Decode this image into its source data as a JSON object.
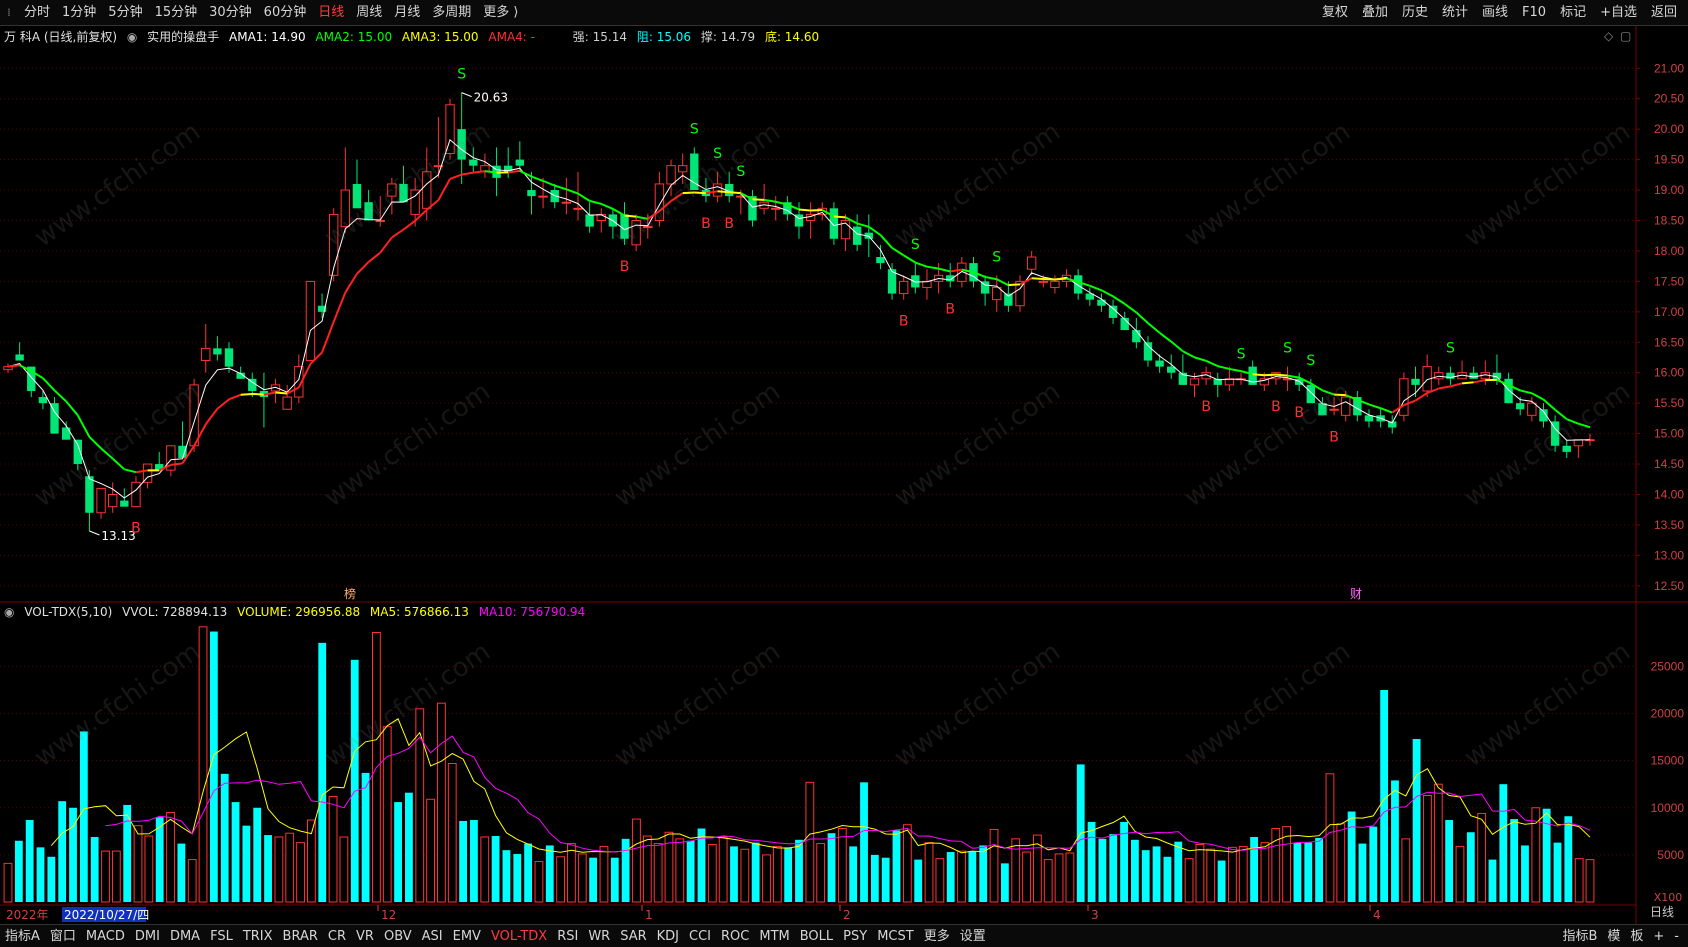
{
  "toolbar": {
    "tabs": [
      "分时",
      "1分钟",
      "5分钟",
      "15分钟",
      "30分钟",
      "60分钟",
      "日线",
      "周线",
      "月线",
      "多周期",
      "更多 ⟩"
    ],
    "active_tab": "日线",
    "right_buttons": [
      "复权",
      "叠加",
      "历史",
      "统计",
      "画线",
      "F10",
      "标记",
      "+自选",
      "返回"
    ]
  },
  "info": {
    "stock": "万 科A (日线,前复权)",
    "indicator": "实用的操盘手",
    "ama1": "AMA1: 14.90",
    "ama2": "AMA2: 15.00",
    "ama3": "AMA3: 15.00",
    "ama4": "AMA4: -",
    "qiang": "强: 15.14",
    "zu": "阻: 15.06",
    "cheng": "撑: 14.79",
    "di": "底: 14.60"
  },
  "vol_info": {
    "name": "VOL-TDX(5,10)",
    "vvol": "VVOL: 728894.13",
    "volume": "VOLUME: 296956.88",
    "ma5": "MA5: 576866.13",
    "ma10": "MA10: 756790.94"
  },
  "colors": {
    "up": "#ff3232",
    "down": "#00e676",
    "vol_down": "#00ffff",
    "ama_white": "#ffffff",
    "ama_red": "#ff2020",
    "ama_yellow": "#ffff00",
    "ama_green": "#00ff00",
    "ma5": "#ffff00",
    "ma10": "#ff00ff",
    "grid": "#5a0000"
  },
  "price_labels": {
    "high": "20.63",
    "low": "13.13"
  },
  "markers": {
    "zhe": "榜",
    "cai": "财"
  },
  "date_labels": {
    "year": "2022年",
    "cursor_date": "2022/10/27/四",
    "months": [
      "12",
      "1",
      "2",
      "3",
      "4"
    ]
  },
  "vol_unit": "X100",
  "bottom": {
    "tabs": [
      "指标A",
      "窗口",
      "MACD",
      "DMI",
      "DMA",
      "FSL",
      "TRIX",
      "BRAR",
      "CR",
      "VR",
      "OBV",
      "ASI",
      "EMV",
      "VOL-TDX",
      "RSI",
      "WR",
      "SAR",
      "KDJ",
      "CCI",
      "ROC",
      "MTM",
      "BOLL",
      "PSY",
      "MCST",
      "更多",
      "设置"
    ],
    "active": "VOL-TDX",
    "right": [
      "指标B",
      "模",
      "板",
      "+",
      "-"
    ],
    "period": "日线"
  },
  "watermark": "www.cfchi.com",
  "chart_data": {
    "type": "candlestick",
    "price_axis": {
      "ticks": [
        21.0,
        20.5,
        20.0,
        19.5,
        19.0,
        18.5,
        18.0,
        17.5,
        17.0,
        16.5,
        16.0,
        15.5,
        15.0,
        14.5,
        14.0,
        13.5,
        13.0,
        12.5
      ],
      "range": [
        12.3,
        21.3
      ]
    },
    "volume_axis": {
      "ticks": [
        25000,
        20000,
        15000,
        10000,
        5000
      ],
      "range": [
        0,
        29500
      ]
    },
    "candles": [
      [
        16.05,
        16.15,
        16.0,
        16.1
      ],
      [
        16.3,
        16.5,
        16.2,
        16.2
      ],
      [
        16.1,
        16.1,
        15.6,
        15.7
      ],
      [
        15.6,
        15.7,
        15.4,
        15.5
      ],
      [
        15.5,
        15.6,
        15.0,
        15.0
      ],
      [
        15.1,
        15.2,
        14.9,
        14.9
      ],
      [
        14.9,
        14.9,
        14.4,
        14.5
      ],
      [
        14.3,
        14.4,
        13.4,
        13.7
      ],
      [
        13.7,
        14.1,
        13.6,
        14.1
      ],
      [
        13.8,
        14.2,
        13.7,
        14.0
      ],
      [
        13.9,
        14.1,
        13.8,
        13.8
      ],
      [
        13.8,
        14.3,
        13.8,
        14.2
      ],
      [
        14.2,
        14.5,
        14.1,
        14.5
      ],
      [
        14.5,
        14.7,
        14.4,
        14.4
      ],
      [
        14.4,
        14.8,
        14.3,
        14.8
      ],
      [
        14.8,
        15.2,
        14.7,
        14.6
      ],
      [
        14.8,
        15.9,
        14.7,
        15.8
      ],
      [
        16.2,
        16.8,
        16.0,
        16.4
      ],
      [
        16.4,
        16.6,
        16.2,
        16.3
      ],
      [
        16.4,
        16.5,
        16.0,
        16.1
      ],
      [
        16.0,
        16.1,
        15.9,
        15.9
      ],
      [
        15.9,
        16.0,
        15.6,
        15.7
      ],
      [
        15.7,
        16.0,
        15.1,
        15.6
      ],
      [
        15.7,
        15.9,
        15.5,
        15.8
      ],
      [
        15.4,
        15.8,
        15.4,
        15.6
      ],
      [
        15.6,
        16.3,
        15.5,
        16.1
      ],
      [
        16.2,
        17.5,
        16.2,
        17.5
      ],
      [
        17.1,
        17.3,
        16.9,
        17.0
      ],
      [
        17.6,
        18.7,
        17.5,
        18.6
      ],
      [
        18.4,
        19.7,
        18.3,
        19.0
      ],
      [
        19.1,
        19.5,
        18.8,
        18.7
      ],
      [
        18.8,
        19.0,
        18.5,
        18.5
      ],
      [
        18.5,
        18.9,
        18.4,
        18.5
      ],
      [
        18.9,
        19.2,
        18.6,
        19.1
      ],
      [
        19.1,
        19.4,
        18.8,
        18.8
      ],
      [
        18.6,
        19.2,
        18.4,
        19.0
      ],
      [
        18.7,
        19.7,
        18.5,
        19.3
      ],
      [
        19.4,
        20.2,
        19.2,
        19.4
      ],
      [
        19.6,
        20.5,
        19.5,
        20.4
      ],
      [
        20.0,
        20.6,
        19.1,
        19.5
      ],
      [
        19.5,
        19.7,
        19.3,
        19.4
      ],
      [
        19.3,
        19.6,
        19.2,
        19.4
      ],
      [
        19.4,
        19.7,
        18.9,
        19.2
      ],
      [
        19.4,
        19.7,
        19.2,
        19.3
      ],
      [
        19.5,
        19.8,
        19.3,
        19.4
      ],
      [
        19.0,
        19.3,
        18.6,
        18.9
      ],
      [
        18.9,
        19.2,
        18.7,
        18.9
      ],
      [
        19.0,
        19.1,
        18.7,
        18.8
      ],
      [
        18.8,
        19.2,
        18.6,
        18.8
      ],
      [
        18.7,
        19.3,
        18.5,
        18.7
      ],
      [
        18.6,
        18.8,
        18.3,
        18.4
      ],
      [
        18.5,
        18.7,
        18.3,
        18.6
      ],
      [
        18.6,
        18.7,
        18.2,
        18.4
      ],
      [
        18.6,
        18.8,
        18.1,
        18.2
      ],
      [
        18.1,
        18.6,
        18.0,
        18.5
      ],
      [
        18.4,
        18.6,
        18.2,
        18.4
      ],
      [
        18.5,
        19.3,
        18.4,
        19.1
      ],
      [
        19.1,
        19.5,
        18.9,
        19.4
      ],
      [
        19.3,
        19.6,
        19.1,
        19.4
      ],
      [
        19.6,
        19.7,
        19.0,
        19.0
      ],
      [
        19.0,
        19.2,
        18.8,
        18.9
      ],
      [
        18.9,
        19.3,
        18.8,
        19.1
      ],
      [
        19.1,
        19.3,
        18.8,
        18.9
      ],
      [
        18.9,
        19.0,
        18.6,
        18.9
      ],
      [
        18.9,
        19.0,
        18.4,
        18.5
      ],
      [
        18.7,
        19.1,
        18.6,
        18.8
      ],
      [
        18.7,
        18.9,
        18.5,
        18.7
      ],
      [
        18.8,
        18.9,
        18.5,
        18.6
      ],
      [
        18.6,
        18.8,
        18.2,
        18.4
      ],
      [
        18.5,
        18.8,
        18.2,
        18.6
      ],
      [
        18.6,
        18.8,
        18.5,
        18.7
      ],
      [
        18.7,
        18.8,
        18.1,
        18.2
      ],
      [
        18.2,
        18.6,
        18.0,
        18.5
      ],
      [
        18.4,
        18.6,
        18.0,
        18.1
      ],
      [
        18.3,
        18.6,
        17.9,
        18.2
      ],
      [
        17.9,
        18.1,
        17.7,
        17.8
      ],
      [
        17.7,
        17.8,
        17.2,
        17.3
      ],
      [
        17.3,
        17.6,
        17.2,
        17.5
      ],
      [
        17.6,
        17.8,
        17.3,
        17.4
      ],
      [
        17.4,
        17.7,
        17.2,
        17.5
      ],
      [
        17.5,
        17.8,
        17.3,
        17.6
      ],
      [
        17.6,
        17.8,
        17.4,
        17.5
      ],
      [
        17.5,
        17.9,
        17.4,
        17.8
      ],
      [
        17.8,
        17.9,
        17.4,
        17.5
      ],
      [
        17.5,
        17.6,
        17.1,
        17.3
      ],
      [
        17.2,
        17.6,
        17.0,
        17.4
      ],
      [
        17.3,
        17.5,
        17.0,
        17.1
      ],
      [
        17.1,
        17.6,
        17.0,
        17.5
      ],
      [
        17.7,
        18.0,
        17.6,
        17.9
      ],
      [
        17.5,
        17.6,
        17.4,
        17.5
      ],
      [
        17.4,
        17.6,
        17.3,
        17.5
      ],
      [
        17.5,
        17.7,
        17.4,
        17.6
      ],
      [
        17.6,
        17.7,
        17.2,
        17.3
      ],
      [
        17.3,
        17.4,
        17.1,
        17.2
      ],
      [
        17.2,
        17.3,
        17.0,
        17.1
      ],
      [
        17.1,
        17.2,
        16.8,
        16.9
      ],
      [
        16.9,
        17.0,
        16.7,
        16.7
      ],
      [
        16.7,
        16.9,
        16.4,
        16.5
      ],
      [
        16.5,
        16.6,
        16.1,
        16.2
      ],
      [
        16.2,
        16.3,
        16.0,
        16.1
      ],
      [
        16.1,
        16.3,
        15.9,
        16.0
      ],
      [
        16.0,
        16.3,
        15.8,
        15.8
      ],
      [
        15.8,
        16.0,
        15.6,
        15.9
      ],
      [
        15.9,
        16.1,
        15.8,
        16.0
      ],
      [
        15.9,
        16.0,
        15.6,
        15.8
      ],
      [
        15.8,
        16.1,
        15.7,
        15.9
      ],
      [
        15.9,
        16.0,
        15.8,
        15.9
      ],
      [
        16.1,
        16.2,
        15.8,
        15.8
      ],
      [
        15.8,
        16.0,
        15.7,
        15.9
      ],
      [
        15.9,
        16.0,
        15.8,
        16.0
      ],
      [
        15.9,
        16.1,
        15.7,
        15.9
      ],
      [
        15.9,
        16.0,
        15.7,
        15.8
      ],
      [
        15.8,
        15.9,
        15.5,
        15.5
      ],
      [
        15.5,
        15.6,
        15.3,
        15.3
      ],
      [
        15.4,
        15.6,
        15.3,
        15.4
      ],
      [
        15.3,
        15.7,
        15.2,
        15.6
      ],
      [
        15.6,
        15.7,
        15.2,
        15.3
      ],
      [
        15.3,
        15.4,
        15.1,
        15.2
      ],
      [
        15.3,
        15.4,
        15.1,
        15.2
      ],
      [
        15.2,
        15.3,
        15.0,
        15.1
      ],
      [
        15.3,
        16.0,
        15.2,
        15.9
      ],
      [
        15.9,
        16.1,
        15.6,
        15.8
      ],
      [
        15.7,
        16.3,
        15.6,
        16.1
      ],
      [
        15.9,
        16.1,
        15.8,
        16.0
      ],
      [
        16.0,
        16.1,
        15.8,
        15.9
      ],
      [
        15.9,
        16.2,
        15.9,
        16.0
      ],
      [
        16.0,
        16.1,
        15.9,
        15.9
      ],
      [
        15.9,
        16.2,
        15.8,
        16.0
      ],
      [
        16.0,
        16.3,
        15.8,
        15.9
      ],
      [
        15.9,
        16.0,
        15.5,
        15.5
      ],
      [
        15.5,
        15.6,
        15.3,
        15.4
      ],
      [
        15.3,
        15.6,
        15.2,
        15.5
      ],
      [
        15.4,
        15.5,
        15.1,
        15.2
      ],
      [
        15.2,
        15.3,
        14.7,
        14.8
      ],
      [
        14.8,
        14.9,
        14.6,
        14.7
      ],
      [
        14.8,
        14.9,
        14.6,
        14.9
      ],
      [
        14.9,
        15.0,
        14.8,
        14.9
      ]
    ],
    "volumes": [
      4100,
      6500,
      8700,
      5800,
      4800,
      10700,
      10000,
      18100,
      6900,
      5400,
      5400,
      10300,
      8100,
      7000,
      9000,
      9500,
      6200,
      4500,
      29200,
      28700,
      13600,
      10600,
      8100,
      10000,
      7100,
      6900,
      7300,
      6300,
      8700,
      27500,
      11200,
      6900,
      25700,
      13700,
      28600,
      18600,
      10600,
      11600,
      20500,
      10900,
      21100,
      14700,
      8600,
      8700,
      6900,
      7000,
      5500,
      5100,
      6200,
      4300,
      6000,
      4800,
      6200,
      5100,
      4700,
      5900,
      4700,
      6700,
      8800,
      7000,
      6200,
      7400,
      6700,
      6500,
      7800,
      6100,
      6900,
      5900,
      5600,
      6300,
      5000,
      5900,
      5800,
      6600,
      12700,
      6200,
      7300,
      7800,
      5900,
      12700,
      5000,
      4700,
      7600,
      8200,
      4500,
      6300,
      4600,
      5300,
      5400,
      5400,
      6000,
      7700,
      4100,
      6700,
      5300,
      7100,
      4500,
      5100,
      5200,
      14600,
      8500,
      6700,
      7200,
      8500,
      6600,
      5500,
      5900,
      4800,
      6400,
      4600,
      6100,
      5600,
      4400,
      5800,
      5900,
      6900,
      6300,
      7800,
      8000,
      6300,
      6300,
      6800,
      13600,
      8300,
      9600,
      6200,
      8000,
      22500,
      12900,
      6700,
      17300,
      11300,
      12500,
      8700,
      5900,
      7400,
      9400,
      4500,
      12500,
      8800,
      6000,
      10000,
      9900,
      6300,
      9100,
      4600,
      4500
    ],
    "ma5": [],
    "ma10": [],
    "annotations": [
      {
        "type": "S",
        "index": 39
      },
      {
        "type": "S",
        "index": 59
      },
      {
        "type": "S",
        "index": 61
      },
      {
        "type": "S",
        "index": 63
      },
      {
        "type": "S",
        "index": 78
      },
      {
        "type": "S",
        "index": 85
      },
      {
        "type": "S",
        "index": 106
      },
      {
        "type": "S",
        "index": 110
      },
      {
        "type": "S",
        "index": 112
      },
      {
        "type": "S",
        "index": 124
      },
      {
        "type": "B",
        "index": 11
      },
      {
        "type": "B",
        "index": 53
      },
      {
        "type": "B",
        "index": 60
      },
      {
        "type": "B",
        "index": 62
      },
      {
        "type": "B",
        "index": 77
      },
      {
        "type": "B",
        "index": 81
      },
      {
        "type": "B",
        "index": 103
      },
      {
        "type": "B",
        "index": 109
      },
      {
        "type": "B",
        "index": 111
      },
      {
        "type": "B",
        "index": 114
      }
    ]
  }
}
